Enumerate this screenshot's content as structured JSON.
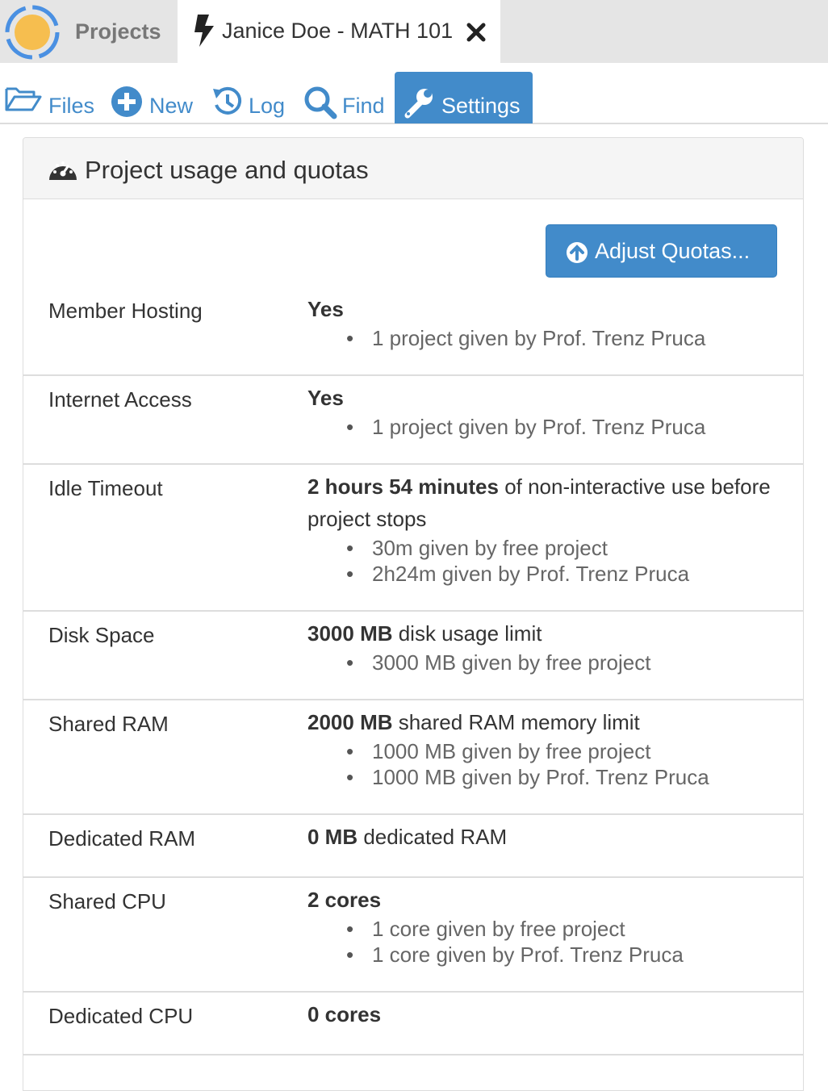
{
  "top_tabs": {
    "projects_label": "Projects",
    "project_title": "Janice Doe - MATH 101"
  },
  "nav": {
    "files": "Files",
    "new": "New",
    "log": "Log",
    "find": "Find",
    "settings": "Settings"
  },
  "panel": {
    "title": "Project usage and quotas",
    "adjust_button": "Adjust Quotas..."
  },
  "rows": [
    {
      "label": "Member Hosting",
      "value_bold": "Yes",
      "value_rest": "",
      "bullets": [
        "1 project given by Prof. Trenz Pruca"
      ]
    },
    {
      "label": "Internet Access",
      "value_bold": "Yes",
      "value_rest": "",
      "bullets": [
        "1 project given by Prof. Trenz Pruca"
      ]
    },
    {
      "label": "Idle Timeout",
      "value_bold": "2 hours 54 minutes",
      "value_rest": " of non-interactive use before project stops",
      "bullets": [
        "30m given by free project",
        "2h24m given by Prof. Trenz Pruca"
      ]
    },
    {
      "label": "Disk Space",
      "value_bold": "3000 MB",
      "value_rest": " disk usage limit",
      "bullets": [
        "3000 MB given by free project"
      ]
    },
    {
      "label": "Shared RAM",
      "value_bold": "2000 MB",
      "value_rest": " shared RAM memory limit",
      "bullets": [
        "1000 MB given by free project",
        "1000 MB given by Prof. Trenz Pruca"
      ]
    },
    {
      "label": "Dedicated RAM",
      "value_bold": "0 MB",
      "value_rest": " dedicated RAM",
      "bullets": []
    },
    {
      "label": "Shared CPU",
      "value_bold": "2 cores",
      "value_rest": "",
      "bullets": [
        "1 core given by free project",
        "1 core given by Prof. Trenz Pruca"
      ]
    },
    {
      "label": "Dedicated CPU",
      "value_bold": "0 cores",
      "value_rest": "",
      "bullets": []
    }
  ],
  "colors": {
    "accent": "#428bca",
    "logo_ring": "#4a90e2",
    "logo_center": "#f6be4f"
  }
}
